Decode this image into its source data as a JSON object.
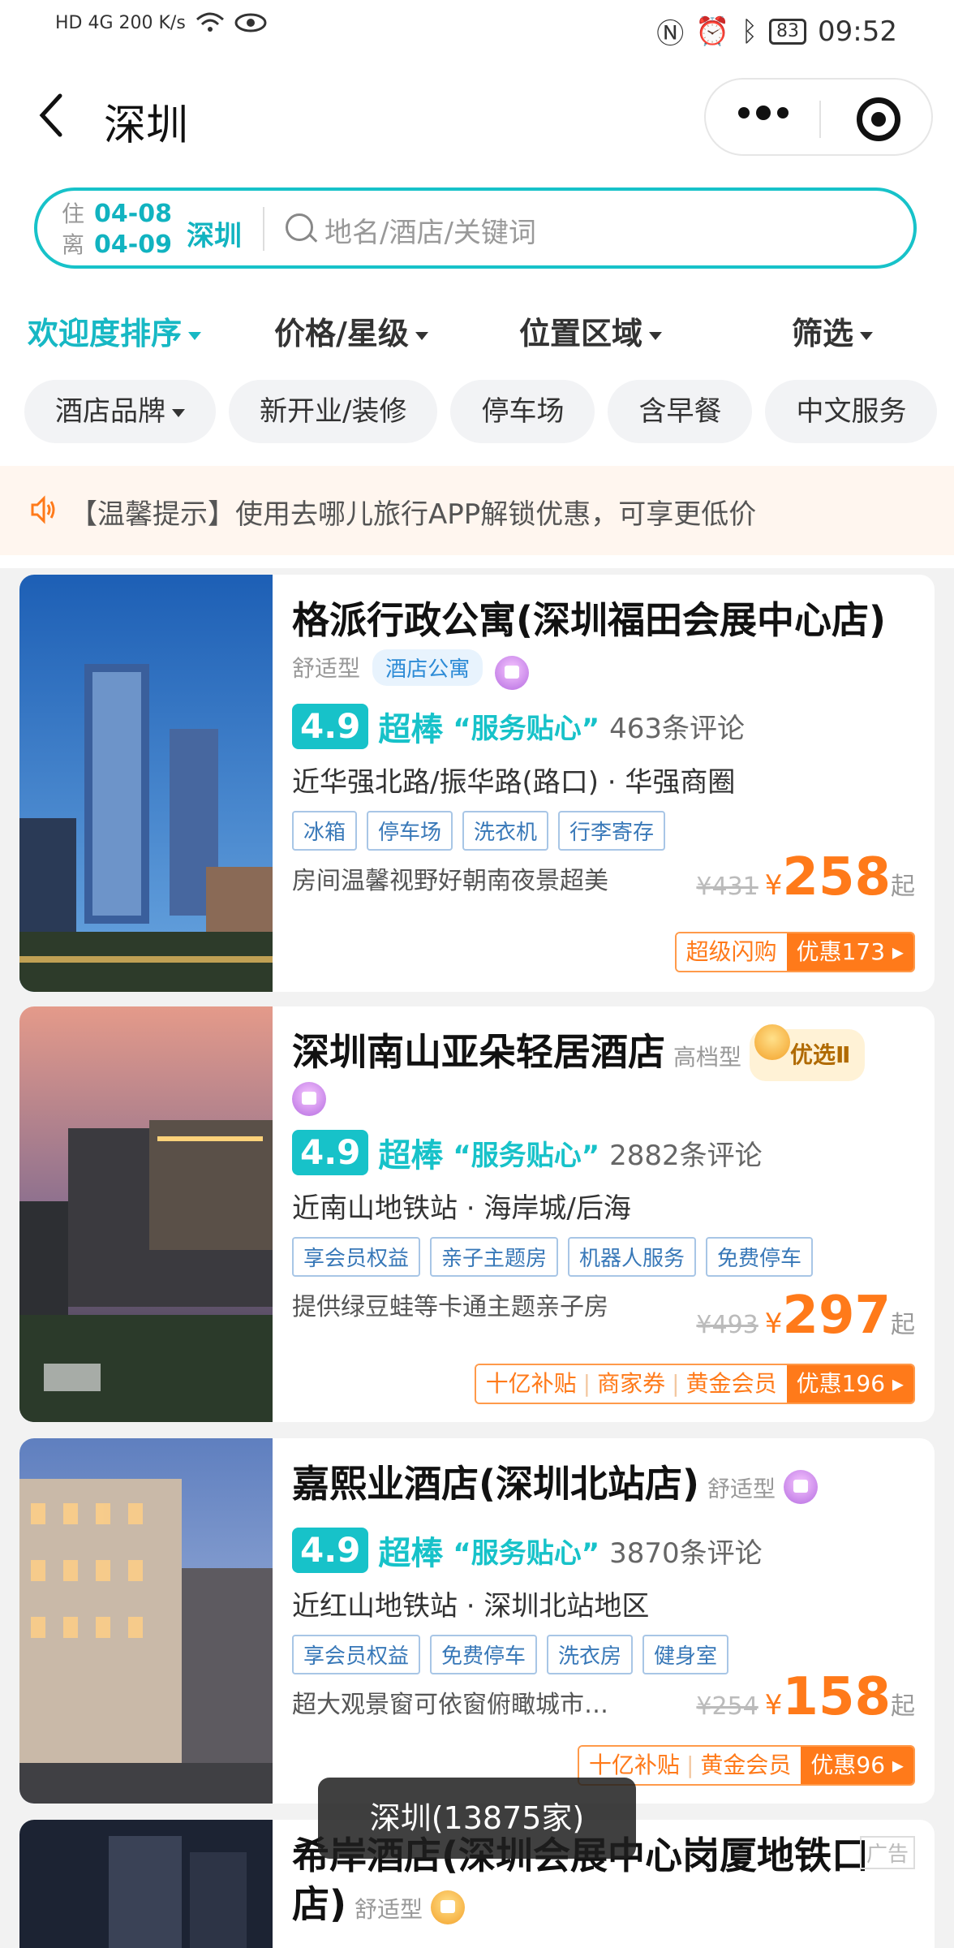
{
  "status": {
    "left": "HD 4G 200 K/s",
    "battery": "83",
    "time": "09:52"
  },
  "nav": {
    "title": "深圳"
  },
  "search": {
    "checkin_label": "住",
    "checkin": "04-08",
    "checkout_label": "离",
    "checkout": "04-09",
    "city": "深圳",
    "placeholder": "地名/酒店/关键词"
  },
  "sorts": [
    "欢迎度排序",
    "价格/星级",
    "位置区域",
    "筛选"
  ],
  "chips": [
    "酒店品牌",
    "新开业/装修",
    "停车场",
    "含早餐",
    "中文服务"
  ],
  "tip": "【温馨提示】使用去哪儿旅行APP解锁优惠，可享更低价",
  "hotels": [
    {
      "name": "格派行政公寓(深圳福田会展中心店)",
      "grade": "舒适型",
      "type_tag": "酒店公寓",
      "score": "4.9",
      "level": "超棒",
      "quote": "“服务贴心”",
      "reviews": "463条评论",
      "location": "近华强北路/振华路(路口) · 华强商圈",
      "tags": [
        "冰箱",
        "停车场",
        "洗衣机",
        "行李寄存"
      ],
      "desc": "房间温馨视野好朝南夜景超美",
      "old_price": "¥431",
      "yen": "¥",
      "price": "258",
      "suffix": "起",
      "promo_left": [
        "超级闪购"
      ],
      "promo_right": "优惠173"
    },
    {
      "name": "深圳南山亚朵轻居酒店",
      "grade": "高档型",
      "badge": "优选Ⅱ",
      "score": "4.9",
      "level": "超棒",
      "quote": "“服务贴心”",
      "reviews": "2882条评论",
      "location": "近南山地铁站 · 海岸城/后海",
      "tags": [
        "享会员权益",
        "亲子主题房",
        "机器人服务",
        "免费停车"
      ],
      "desc": "提供绿豆蛙等卡通主题亲子房",
      "old_price": "¥493",
      "yen": "¥",
      "price": "297",
      "suffix": "起",
      "promo_left": [
        "十亿补贴",
        "商家券",
        "黄金会员"
      ],
      "promo_right": "优惠196"
    },
    {
      "name": "嘉熙业酒店(深圳北站店)",
      "grade": "舒适型",
      "score": "4.9",
      "level": "超棒",
      "quote": "“服务贴心”",
      "reviews": "3870条评论",
      "location": "近红山地铁站 · 深圳北站地区",
      "tags": [
        "享会员权益",
        "免费停车",
        "洗衣房",
        "健身室"
      ],
      "desc": "超大观景窗可依窗俯瞰城市…",
      "old_price": "¥254",
      "yen": "¥",
      "price": "158",
      "suffix": "起",
      "promo_left": [
        "十亿补贴",
        "黄金会员"
      ],
      "promo_right": "优惠96"
    },
    {
      "name": "希岸酒店(深圳会展中心岗厦地铁口店)",
      "grade": "舒适型",
      "ad": "广告"
    }
  ],
  "toast": "深圳(13875家)"
}
